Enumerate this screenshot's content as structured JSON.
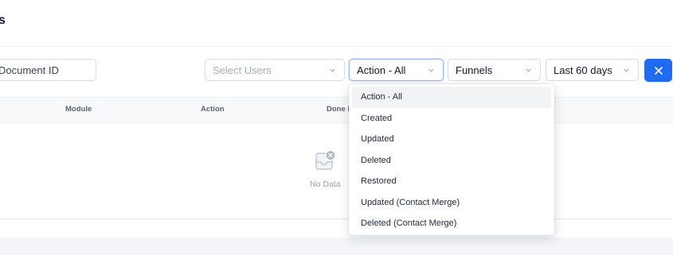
{
  "header": {
    "title_fragment": "s"
  },
  "filters": {
    "search_value": "Document ID",
    "users_placeholder": "Select Users",
    "action_value": "Action - All",
    "funnels_value": "Funnels",
    "period_value": "Last 60 days"
  },
  "table": {
    "columns": [
      "Module",
      "Action",
      "Done b"
    ],
    "empty_text": "No Data"
  },
  "dropdown": {
    "options": [
      "Action - All",
      "Created",
      "Updated",
      "Deleted",
      "Restored",
      "Updated (Contact Merge)",
      "Deleted (Contact Merge)"
    ],
    "selected": "Action - All"
  },
  "colors": {
    "accent": "#1f6bf2",
    "border": "#d9dce1",
    "muted_text": "#9aa1ac"
  },
  "icons": {
    "close_button": "close-icon",
    "select_chevron": "chevron-down-icon",
    "empty_state": "empty-inbox-icon"
  }
}
